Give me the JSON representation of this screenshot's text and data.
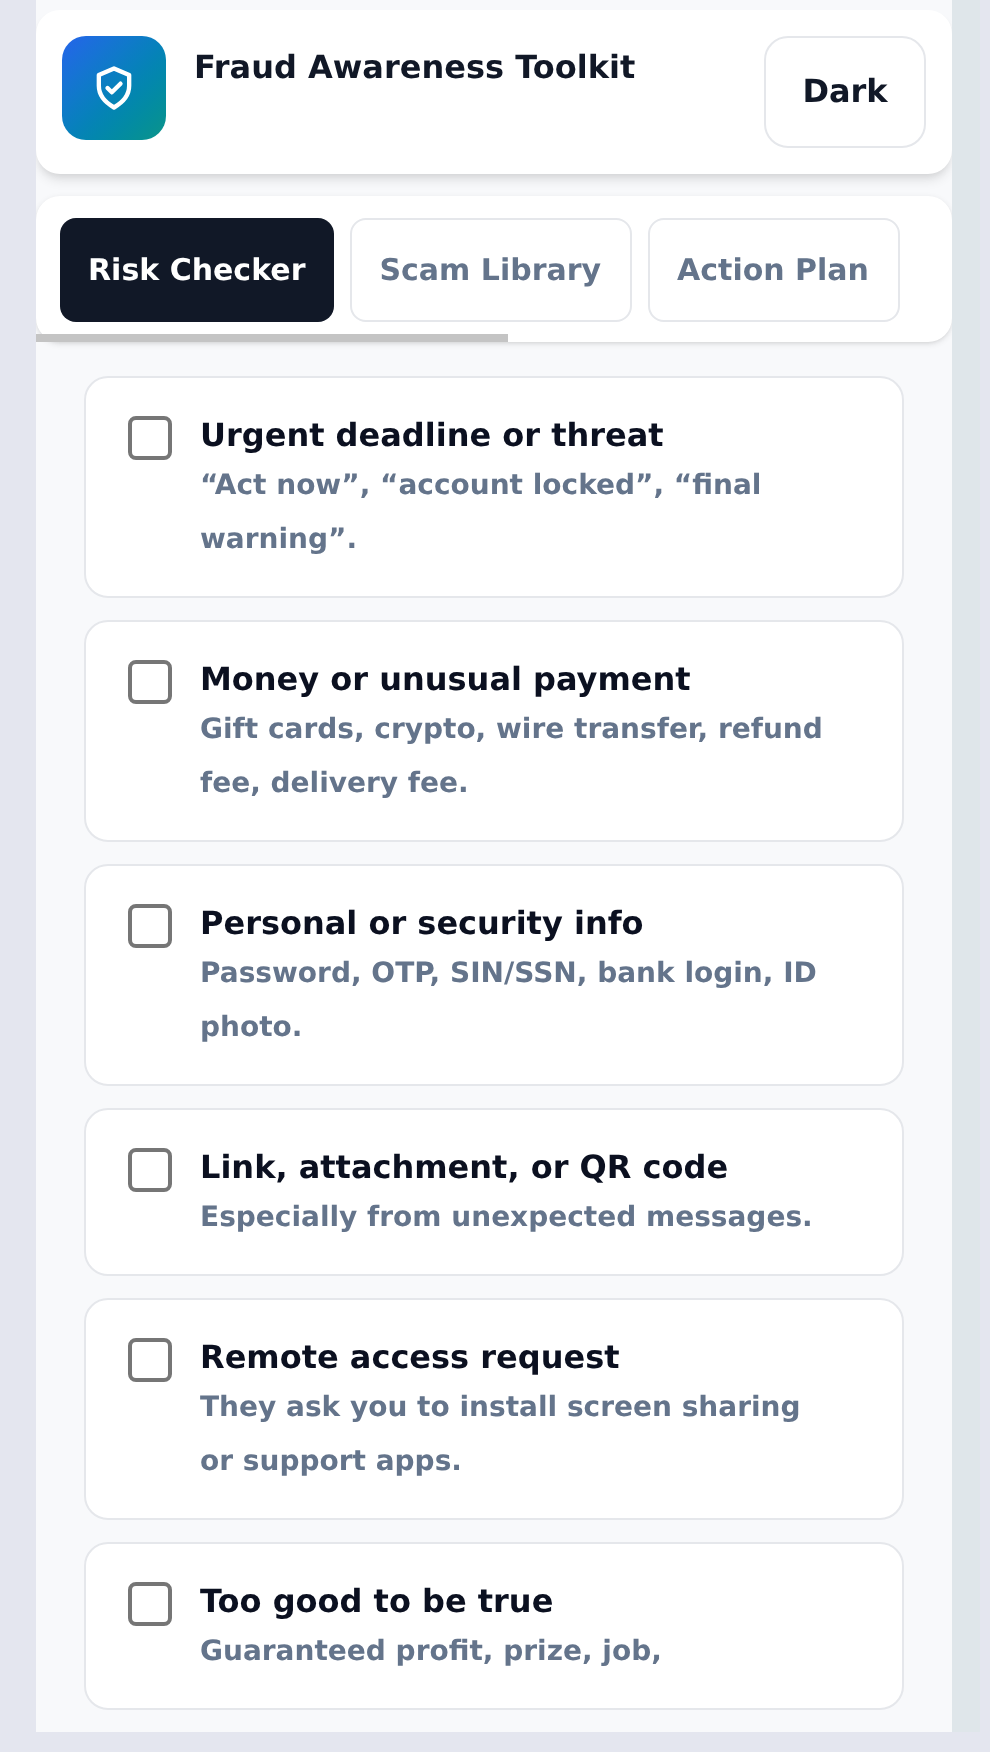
{
  "header": {
    "title": "Fraud Awareness Toolkit",
    "theme_button": "Dark"
  },
  "tabs": [
    {
      "label": "Risk Checker",
      "selected": true
    },
    {
      "label": "Scam Library",
      "selected": false
    },
    {
      "label": "Action Plan",
      "selected": false
    }
  ],
  "checklist": [
    {
      "title": "Urgent deadline or threat",
      "description": "“Act now”, “account locked”, “final warning”.",
      "checked": false
    },
    {
      "title": "Money or unusual payment",
      "description": "Gift cards, crypto, wire transfer, refund fee, delivery fee.",
      "checked": false
    },
    {
      "title": "Personal or security info",
      "description": "Password, OTP, SIN/SSN, bank login, ID photo.",
      "checked": false
    },
    {
      "title": "Link, attachment, or QR code",
      "description": "Especially from unexpected messages.",
      "checked": false
    },
    {
      "title": "Remote access request",
      "description": "They ask you to install screen sharing or support apps.",
      "checked": false
    },
    {
      "title": "Too good to be true",
      "description": "Guaranteed profit, prize, job,",
      "checked": false
    }
  ]
}
